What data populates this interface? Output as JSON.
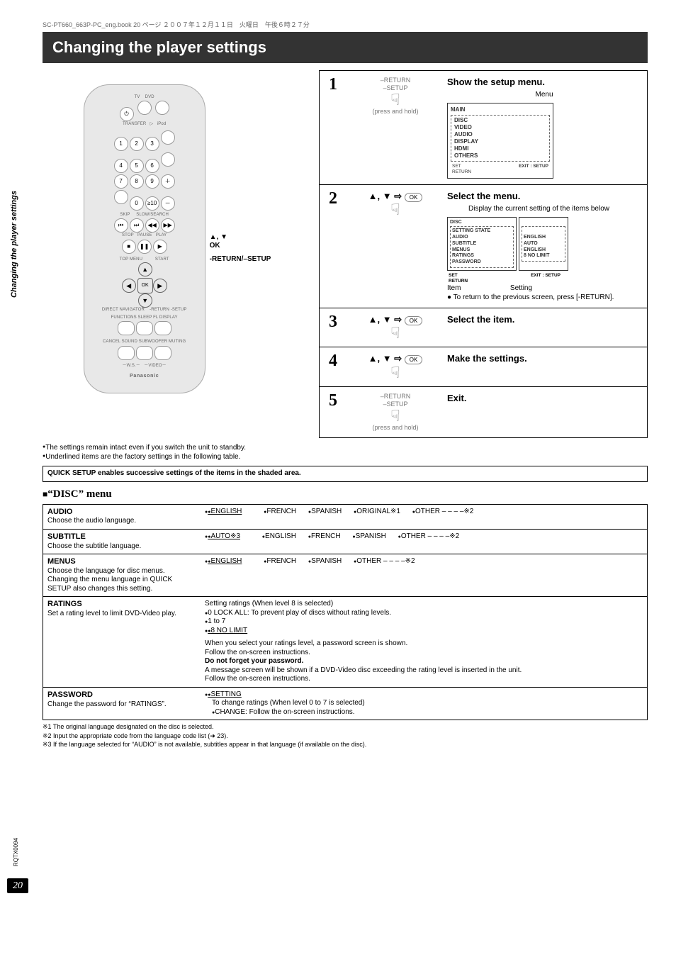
{
  "meta": {
    "header_strip": "SC-PT660_663P-PC_eng.book  20 ページ  ２００７年１２月１１日　火曜日　午後６時２７分"
  },
  "title_bar": "Changing the player settings",
  "side_title": "Changing the player settings",
  "page_num": "20",
  "model_code": "RQTX0094",
  "remote": {
    "ok": "OK",
    "return": "-RETURN",
    "setup": "-SETUP",
    "brand": "Panasonic",
    "anno_arrows": "▲, ▼",
    "anno_ok": "OK",
    "anno_return": "-RETURN/–SETUP"
  },
  "steps": [
    {
      "num": "1",
      "action_line1": "–RETURN",
      "action_line2": "–SETUP",
      "action_note": "(press and hold)",
      "title": "Show the setup menu.",
      "body": "Menu",
      "menu_title": "MAIN",
      "menu_items": "DISC\nVIDEO\nAUDIO\nDISPLAY\nHDMI\nOTHERS",
      "foot_left": "SET\nRETURN",
      "foot_right": "EXIT : SETUP"
    },
    {
      "num": "2",
      "action_arrows": "▲, ▼ ⇨",
      "action_ok": "OK",
      "title": "Select the menu.",
      "body": "Display the current setting of the items below",
      "menu_title": "DISC",
      "left_col": "SETTING STATE\nAUDIO\nSUBTITLE\nMENUS\nRATINGS\nPASSWORD",
      "right_col": "\nENGLISH\nAUTO\nENGLISH\n8 NO LIMIT\n",
      "labels": "Item                         Setting",
      "foot_left": "SET\nRETURN",
      "foot_right": "EXIT : SETUP",
      "note": "To return to the previous screen, press [-RETURN]."
    },
    {
      "num": "3",
      "action_arrows": "▲, ▼ ⇨",
      "action_ok": "OK",
      "title": "Select the item."
    },
    {
      "num": "4",
      "action_arrows": "▲, ▼ ⇨",
      "action_ok": "OK",
      "title": "Make the settings."
    },
    {
      "num": "5",
      "action_line1": "–RETURN",
      "action_line2": "–SETUP",
      "action_note": "(press and hold)",
      "title": "Exit."
    }
  ],
  "pre_notes": [
    "The settings remain intact even if you switch the unit to standby.",
    "Underlined items are the factory settings in the following table."
  ],
  "shaded_note": "QUICK SETUP enables successive settings of the items in the shaded area.",
  "disc_menu_heading": "“DISC” menu",
  "disc_rows": {
    "audio": {
      "label": "AUDIO",
      "desc": "Choose the audio language.",
      "opts": [
        {
          "t": "ENGLISH",
          "u": true
        },
        {
          "t": "FRENCH"
        },
        {
          "t": "SPANISH"
        },
        {
          "t": "ORIGINAL※1"
        },
        {
          "t": "OTHER – – – –※2"
        }
      ]
    },
    "subtitle": {
      "label": "SUBTITLE",
      "desc": "Choose the subtitle language.",
      "opts": [
        {
          "t": "AUTO※3",
          "u": true
        },
        {
          "t": "ENGLISH"
        },
        {
          "t": "FRENCH"
        },
        {
          "t": "SPANISH"
        },
        {
          "t": "OTHER – – – –※2"
        }
      ]
    },
    "menus": {
      "label": "MENUS",
      "desc": "Choose the language for disc menus. Changing the menu language in QUICK SETUP also changes this setting.",
      "opts": [
        {
          "t": "ENGLISH",
          "u": true
        },
        {
          "t": "FRENCH"
        },
        {
          "t": "SPANISH"
        },
        {
          "t": "OTHER – – – –※2"
        }
      ]
    },
    "ratings": {
      "label": "RATINGS",
      "desc": "Set a rating level to limit DVD-Video play.",
      "l1": "Setting ratings (When level 8 is selected)",
      "l2": "0 LOCK ALL: To prevent play of discs without rating levels.",
      "l3": "1 to 7",
      "l4": "8 NO LIMIT",
      "p1": "When you select your ratings level, a password screen is shown.",
      "p2": "Follow the on-screen instructions.",
      "p3": "Do not forget your password.",
      "p4": "A message screen will be shown if a DVD-Video disc exceeding the rating level is inserted in the unit.",
      "p5": "Follow the on-screen instructions."
    },
    "password": {
      "label": "PASSWORD",
      "desc": "Change the password for “RATINGS”.",
      "opt": "SETTING",
      "p1": "To change ratings (When level 0 to 7 is selected)",
      "p2": "CHANGE: Follow the on-screen instructions."
    }
  },
  "footnotes": [
    "※1 The original language designated on the disc is selected.",
    "※2 Input the appropriate code from the language code list (➜ 23).",
    "※3 If the language selected for “AUDIO” is not available, subtitles appear in that language (if available on the disc)."
  ]
}
